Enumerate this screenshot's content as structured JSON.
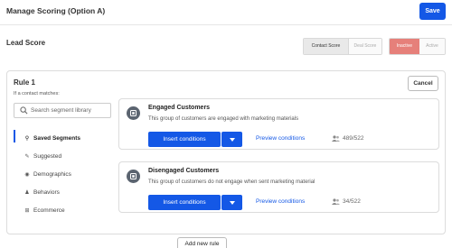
{
  "header": {
    "title": "Manage Scoring (Option A)",
    "save_label": "Save"
  },
  "lead": {
    "title": "Lead Score",
    "score_type": [
      "Contact Score",
      "Deal Score"
    ],
    "status": [
      "Inactive",
      "Active"
    ],
    "colors": {
      "inactive": "#e6807a",
      "accent": "#1458e6"
    }
  },
  "rule": {
    "title": "Rule 1",
    "subtitle": "If a contact matches:",
    "cancel_label": "Cancel",
    "search_placeholder": "Search segment library",
    "nav": [
      {
        "label": "Saved Segments",
        "icon": "bookmark-icon"
      },
      {
        "label": "Suggested",
        "icon": "lightbulb-icon"
      },
      {
        "label": "Demographics",
        "icon": "location-icon"
      },
      {
        "label": "Behaviors",
        "icon": "person-icon"
      },
      {
        "label": "Ecommerce",
        "icon": "cart-icon"
      }
    ],
    "segments": [
      {
        "name": "Engaged Customers",
        "description": "This group of customers are engaged with marketing materials",
        "insert_label": "Insert conditions",
        "preview_label": "Preview conditions",
        "count": "489/522"
      },
      {
        "name": "Disengaged Customers",
        "description": "This group of customers do not engage when sent marketing material",
        "insert_label": "Insert conditions",
        "preview_label": "Preview conditions",
        "count": "34/522"
      }
    ]
  },
  "add_rule_label": "Add new rule"
}
